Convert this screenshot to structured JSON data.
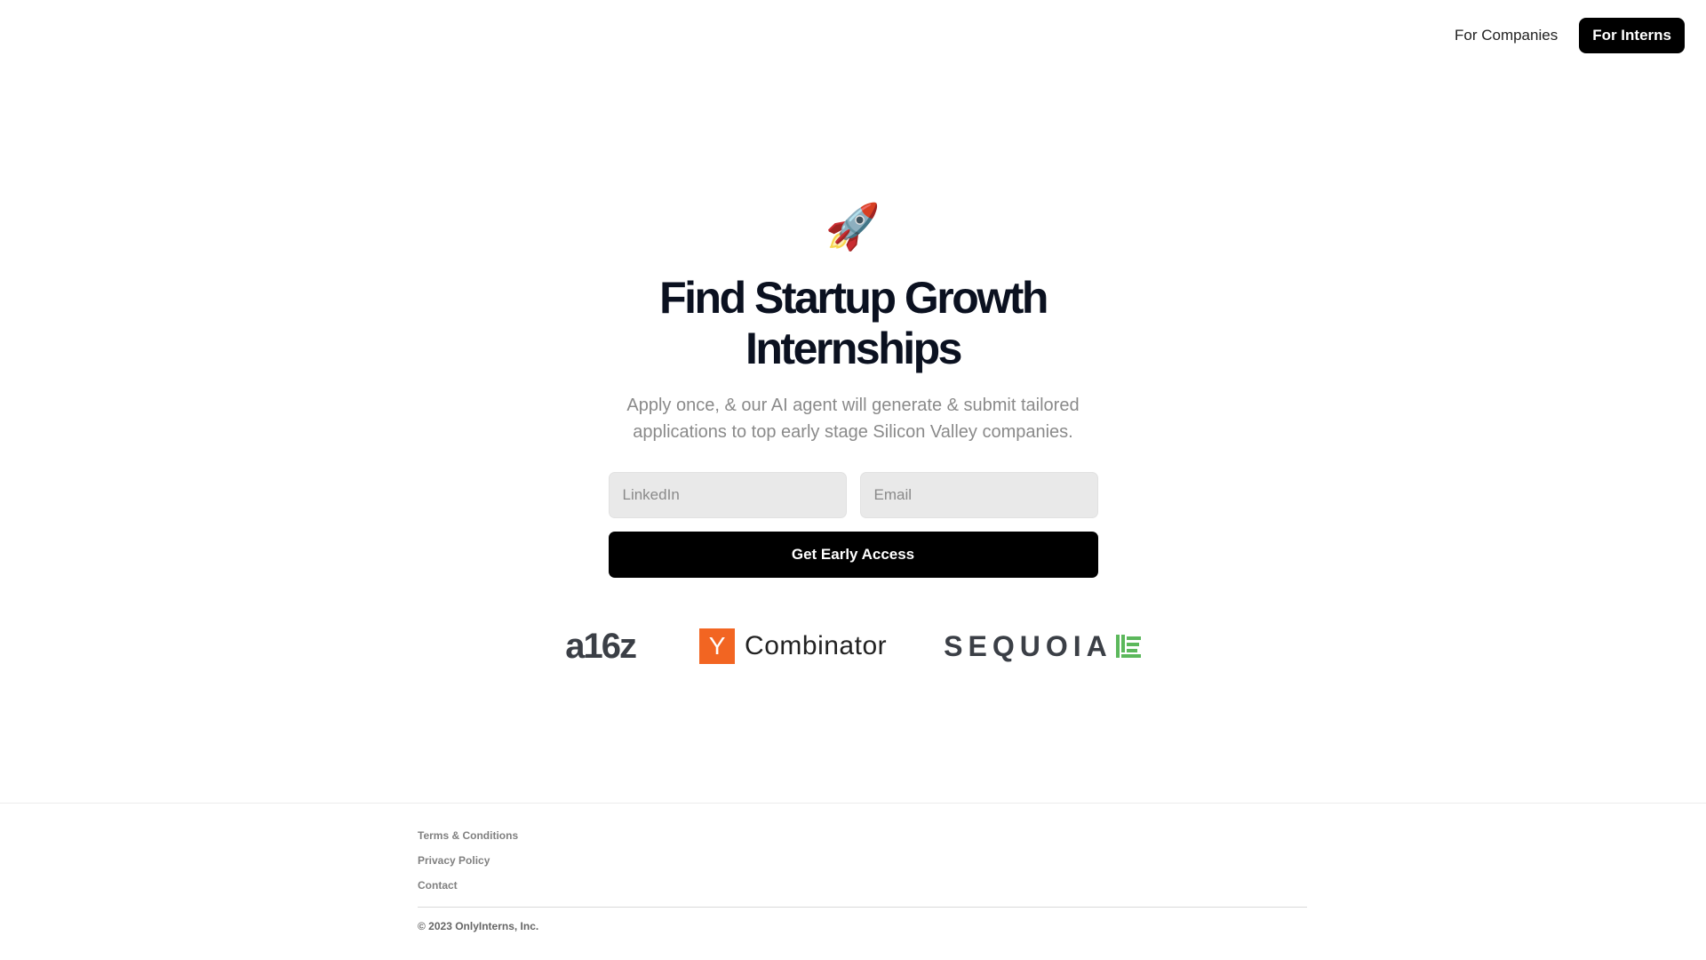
{
  "nav": {
    "companies_label": "For Companies",
    "interns_label": "For Interns"
  },
  "hero": {
    "emoji": "🚀",
    "title": "Find Startup Growth Internships",
    "subtitle": "Apply once, & our AI agent will generate & submit tailored applications to top early stage Silicon Valley companies."
  },
  "form": {
    "linkedin_placeholder": "LinkedIn",
    "email_placeholder": "Email",
    "submit_label": "Get Early Access"
  },
  "backers": {
    "a16z": "a16z",
    "yc_box": "Y",
    "yc_text": "Combinator",
    "sequoia": "SEQUOIA"
  },
  "footer": {
    "links": [
      "Terms & Conditions",
      "Privacy Policy",
      "Contact"
    ],
    "copyright": "© 2023 OnlyInterns, Inc."
  },
  "colors": {
    "primary": "#000000",
    "yc_orange": "#f26522",
    "sequoia_green": "#5cb85c",
    "subtitle_gray": "#8a8a8a"
  }
}
